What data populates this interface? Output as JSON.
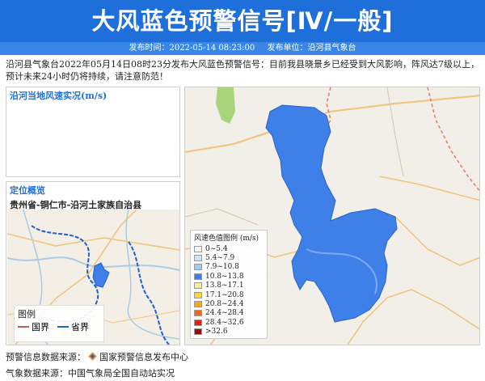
{
  "header": {
    "title": "大风蓝色预警信号[Ⅳ/一般]",
    "publish_time_label": "发布时间：2022-05-14 08:23:00",
    "publish_unit_label": "发布单位：沿河县气象台"
  },
  "description": "沿河县气象台2022年05月14日08时23分发布大风蓝色预警信号：目前我县晓景乡已经受到大风影响，阵风达7级以上，预计未来24小时仍将持续，请注意防范！",
  "wind_panel": {
    "title": "沿河当地风速实况(m/s)"
  },
  "location_panel": {
    "title": "定位概览",
    "region": "贵州省-铜仁市-沿河土家族自治县",
    "legend": {
      "title": "图例",
      "items": [
        {
          "label": "国界",
          "color": "#c85a5a"
        },
        {
          "label": "省界",
          "color": "#1e5fd0"
        }
      ]
    }
  },
  "main_map": {
    "region_color": "#3f7fe8",
    "color_legend": {
      "title": "风速色值图例 (m/s)",
      "items": [
        {
          "label": "0~5.4",
          "color": "#f4f4f4"
        },
        {
          "label": "5.4~7.9",
          "color": "#cfe4f7"
        },
        {
          "label": "7.9~10.8",
          "color": "#9fcbf0"
        },
        {
          "label": "10.8~13.8",
          "color": "#3f7fe8"
        },
        {
          "label": "13.8~17.1",
          "color": "#f6ed9a"
        },
        {
          "label": "17.1~20.8",
          "color": "#f5d640"
        },
        {
          "label": "20.8~24.4",
          "color": "#f5a623"
        },
        {
          "label": "24.4~28.4",
          "color": "#ef6a1e"
        },
        {
          "label": "28.4~32.6",
          "color": "#d1261c"
        },
        {
          "label": ">32.6",
          "color": "#8c0f12"
        }
      ]
    }
  },
  "footer": {
    "warning_source": "预警信息数据来源：",
    "warning_source_name": "国家预警信息发布中心",
    "weather_source": "气象数据来源：中国气象局全国自动站实况"
  }
}
